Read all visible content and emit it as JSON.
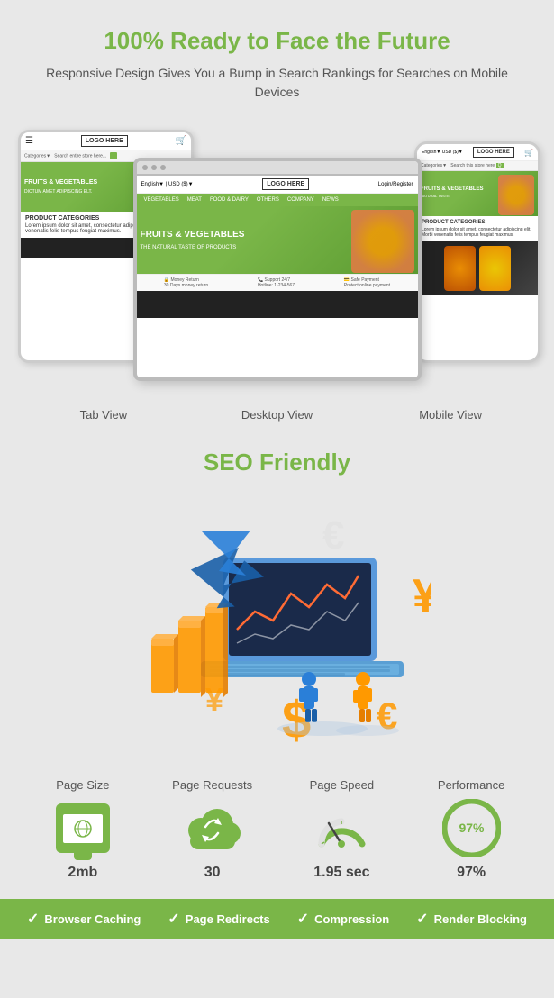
{
  "header": {
    "title": "100% Ready to Face the Future",
    "subtitle": "Responsive Design Gives You a Bump in Search Rankings for Searches on Mobile Devices"
  },
  "devices": {
    "tab_label": "Tab View",
    "desktop_label": "Desktop View",
    "mobile_label": "Mobile View",
    "logo_text": "LOGO HERE"
  },
  "seo": {
    "title": "SEO Friendly"
  },
  "stats": [
    {
      "label": "Page Size",
      "value": "2mb",
      "icon": "monitor-icon"
    },
    {
      "label": "Page Requests",
      "value": "30",
      "icon": "cloud-icon"
    },
    {
      "label": "Page Speed",
      "value": "1.95 sec",
      "icon": "speedometer-icon"
    },
    {
      "label": "Performance",
      "value": "97%",
      "icon": "performance-icon",
      "percent": 97
    }
  ],
  "bottom_bar": [
    {
      "label": "Browser Caching"
    },
    {
      "label": "Page Redirects"
    },
    {
      "label": "Compression"
    },
    {
      "label": "Render Blocking"
    }
  ]
}
